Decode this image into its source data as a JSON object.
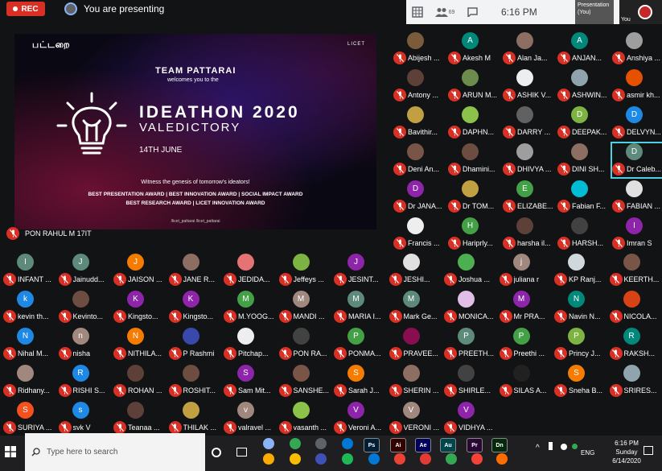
{
  "meet": {
    "rec_label": "REC",
    "presenting_text": "You are presenting",
    "clock": "6:16 PM",
    "people_badge": "69",
    "self_tile_label": "Presentation (You)",
    "you_tile_label": "You"
  },
  "slide": {
    "logo_left": "பட்டறை",
    "logo_right": "LICET",
    "team": "TEAM PATTARAI",
    "welcome": "welcomes you to the",
    "title": "IDEATHON 2020",
    "subtitle": "VALEDICTORY",
    "date": "14TH JUNE",
    "witness": "Witness the genesis of tomorrow's ideators!",
    "awards_line1": "BEST PRESENTATION AWARD | BEST INNOVATION AWARD | SOCIAL IMPACT AWARD",
    "awards_line2": "BEST RESEARCH AWARD | LICET INNOVATION AWARD",
    "socials": "/licet_pattarai     /licet_pattarai"
  },
  "presenter": {
    "name": "PON RAHUL M 17IT"
  },
  "participants": [
    {
      "name": "Abijesh ...",
      "initial": "",
      "color": "#7a5c3d"
    },
    {
      "name": "Akesh M",
      "initial": "A",
      "color": "#00897b"
    },
    {
      "name": "Alan Ja...",
      "initial": "",
      "color": "#8d6e63"
    },
    {
      "name": "ANJAN...",
      "initial": "A",
      "color": "#00897b"
    },
    {
      "name": "Anshiya ...",
      "initial": "",
      "color": "#9e9e9e"
    },
    {
      "name": "Antony ...",
      "initial": "",
      "color": "#5d4037"
    },
    {
      "name": "ARUN M...",
      "initial": "",
      "color": "#6d8b4c"
    },
    {
      "name": "ASHIK V...",
      "initial": "",
      "color": "#eeeeee"
    },
    {
      "name": "ASHWIN...",
      "initial": "",
      "color": "#90a4ae"
    },
    {
      "name": "asmir kh...",
      "initial": "",
      "color": "#e65100"
    },
    {
      "name": "Bavithir...",
      "initial": "",
      "color": "#c0a040"
    },
    {
      "name": "DAPHN...",
      "initial": "",
      "color": "#8bc34a"
    },
    {
      "name": "DARRY ...",
      "initial": "",
      "color": "#616161"
    },
    {
      "name": "DEEPAK...",
      "initial": "D",
      "color": "#7cb342"
    },
    {
      "name": "DELVYN...",
      "initial": "D",
      "color": "#1e88e5"
    },
    {
      "name": "Deni An...",
      "initial": "",
      "color": "#795548"
    },
    {
      "name": "Dhamini...",
      "initial": "",
      "color": "#6d4c41"
    },
    {
      "name": "DHIVYA ...",
      "initial": "",
      "color": "#9e9e9e"
    },
    {
      "name": "DINI SH...",
      "initial": "",
      "color": "#8d6e63"
    },
    {
      "name": "Dr Caleb...",
      "initial": "D",
      "color": "#5d8a7a"
    },
    {
      "name": "Dr JANA...",
      "initial": "D",
      "color": "#8e24aa"
    },
    {
      "name": "Dr TOM...",
      "initial": "",
      "color": "#c0a040"
    },
    {
      "name": "ELIZABE...",
      "initial": "E",
      "color": "#43a047"
    },
    {
      "name": "Fabian F...",
      "initial": "",
      "color": "#00bcd4"
    },
    {
      "name": "FABIAN ...",
      "initial": "",
      "color": "#e0e0e0"
    },
    {
      "name": "Francis ...",
      "initial": "",
      "color": "#eeeeee"
    },
    {
      "name": "Hariprly...",
      "initial": "H",
      "color": "#43a047"
    },
    {
      "name": "harsha il...",
      "initial": "",
      "color": "#5d4037"
    },
    {
      "name": "HARSH...",
      "initial": "",
      "color": "#424242"
    },
    {
      "name": "Imran S",
      "initial": "I",
      "color": "#8e24aa"
    },
    {
      "name": "INFANT ...",
      "initial": "I",
      "color": "#5d8a7a"
    },
    {
      "name": "Jainudd...",
      "initial": "J",
      "color": "#5d8a7a"
    },
    {
      "name": "JAISON ...",
      "initial": "J",
      "color": "#f57c00"
    },
    {
      "name": "JANE R...",
      "initial": "",
      "color": "#8d6e63"
    },
    {
      "name": "JEDIDA...",
      "initial": "",
      "color": "#e57373"
    },
    {
      "name": "Jeffeys ...",
      "initial": "",
      "color": "#7cb342"
    },
    {
      "name": "JESINT...",
      "initial": "J",
      "color": "#8e24aa"
    },
    {
      "name": "JESHI...",
      "initial": "",
      "color": "#e0e0e0"
    },
    {
      "name": "Joshua ...",
      "initial": "",
      "color": "#4caf50"
    },
    {
      "name": "juliana r",
      "initial": "j",
      "color": "#a1887f"
    },
    {
      "name": "KP Ranj...",
      "initial": "",
      "color": "#cfd8dc"
    },
    {
      "name": "KEERTH...",
      "initial": "",
      "color": "#795548"
    },
    {
      "name": "kevin th...",
      "initial": "k",
      "color": "#1e88e5"
    },
    {
      "name": "Kevinto...",
      "initial": "",
      "color": "#6d4c41"
    },
    {
      "name": "Kingsto...",
      "initial": "K",
      "color": "#8e24aa"
    },
    {
      "name": "Kingsto...",
      "initial": "K",
      "color": "#8e24aa"
    },
    {
      "name": "M.YOOG...",
      "initial": "M",
      "color": "#43a047"
    },
    {
      "name": "MANDI ...",
      "initial": "M",
      "color": "#a1887f"
    },
    {
      "name": "MARIA I...",
      "initial": "M",
      "color": "#5d8a7a"
    },
    {
      "name": "Mark Ge...",
      "initial": "M",
      "color": "#5d8a7a"
    },
    {
      "name": "MONICA...",
      "initial": "",
      "color": "#e1bee7"
    },
    {
      "name": "Mr PRA...",
      "initial": "M",
      "color": "#8e24aa"
    },
    {
      "name": "Navin N...",
      "initial": "N",
      "color": "#00897b"
    },
    {
      "name": "NICOLA...",
      "initial": "",
      "color": "#d84315"
    },
    {
      "name": "Nihal M...",
      "initial": "N",
      "color": "#1e88e5"
    },
    {
      "name": "nisha",
      "initial": "n",
      "color": "#a1887f"
    },
    {
      "name": "NITHILA...",
      "initial": "N",
      "color": "#f57c00"
    },
    {
      "name": "P Rashmi",
      "initial": "",
      "color": "#3949ab"
    },
    {
      "name": "Pitchap...",
      "initial": "",
      "color": "#eeeeee"
    },
    {
      "name": "PON RA...",
      "initial": "",
      "color": "#424242"
    },
    {
      "name": "PONMA...",
      "initial": "P",
      "color": "#43a047"
    },
    {
      "name": "PRAVEE...",
      "initial": "",
      "color": "#880e4f"
    },
    {
      "name": "PREETH...",
      "initial": "P",
      "color": "#5d8a7a"
    },
    {
      "name": "Preethi ...",
      "initial": "P",
      "color": "#43a047"
    },
    {
      "name": "Princy J...",
      "initial": "P",
      "color": "#7cb342"
    },
    {
      "name": "RAKSH...",
      "initial": "R",
      "color": "#00897b"
    },
    {
      "name": "Ridhany...",
      "initial": "",
      "color": "#a1887f"
    },
    {
      "name": "RISHI S...",
      "initial": "R",
      "color": "#1e88e5"
    },
    {
      "name": "ROHAN ...",
      "initial": "",
      "color": "#5d4037"
    },
    {
      "name": "ROSHIT...",
      "initial": "",
      "color": "#6d4c41"
    },
    {
      "name": "Sam Mit...",
      "initial": "S",
      "color": "#8e24aa"
    },
    {
      "name": "SANSHE...",
      "initial": "",
      "color": "#795548"
    },
    {
      "name": "Sarah J...",
      "initial": "S",
      "color": "#f57c00"
    },
    {
      "name": "SHERIN ...",
      "initial": "",
      "color": "#8d6e63"
    },
    {
      "name": "SHIRLE...",
      "initial": "",
      "color": "#424242"
    },
    {
      "name": "SILAS A...",
      "initial": "",
      "color": "#212121"
    },
    {
      "name": "Sneha B...",
      "initial": "S",
      "color": "#f57c00"
    },
    {
      "name": "SRIRES...",
      "initial": "",
      "color": "#90a4ae"
    },
    {
      "name": "SURIYA ...",
      "initial": "S",
      "color": "#f4511e"
    },
    {
      "name": "svk V",
      "initial": "s",
      "color": "#1e88e5"
    },
    {
      "name": "Teanaa ...",
      "initial": "",
      "color": "#5d4037"
    },
    {
      "name": "THILAK ...",
      "initial": "",
      "color": "#c0a040"
    },
    {
      "name": "valravel ...",
      "initial": "v",
      "color": "#a1887f"
    },
    {
      "name": "vasanth ...",
      "initial": "",
      "color": "#8bc34a"
    },
    {
      "name": "Veroni A...",
      "initial": "V",
      "color": "#8e24aa"
    },
    {
      "name": "VERONI ...",
      "initial": "V",
      "color": "#a1887f"
    },
    {
      "name": "VIDHYA ...",
      "initial": "V",
      "color": "#8e24aa"
    }
  ],
  "taskbar": {
    "search_placeholder": "Type here to search",
    "apps": [
      {
        "name": "ps-app",
        "label": "Ps",
        "color": "#001e36"
      },
      {
        "name": "ai-app",
        "label": "Ai",
        "color": "#330000"
      },
      {
        "name": "ae-app",
        "label": "Ae",
        "color": "#00005b"
      },
      {
        "name": "au-app",
        "label": "Au",
        "color": "#00474d"
      },
      {
        "name": "pr-app",
        "label": "Pr",
        "color": "#2a0634"
      },
      {
        "name": "dn-app",
        "label": "Dn",
        "color": "#052a0b"
      }
    ],
    "lang": "ENG",
    "time": "6:16 PM",
    "day": "Sunday",
    "date": "6/14/2020"
  }
}
